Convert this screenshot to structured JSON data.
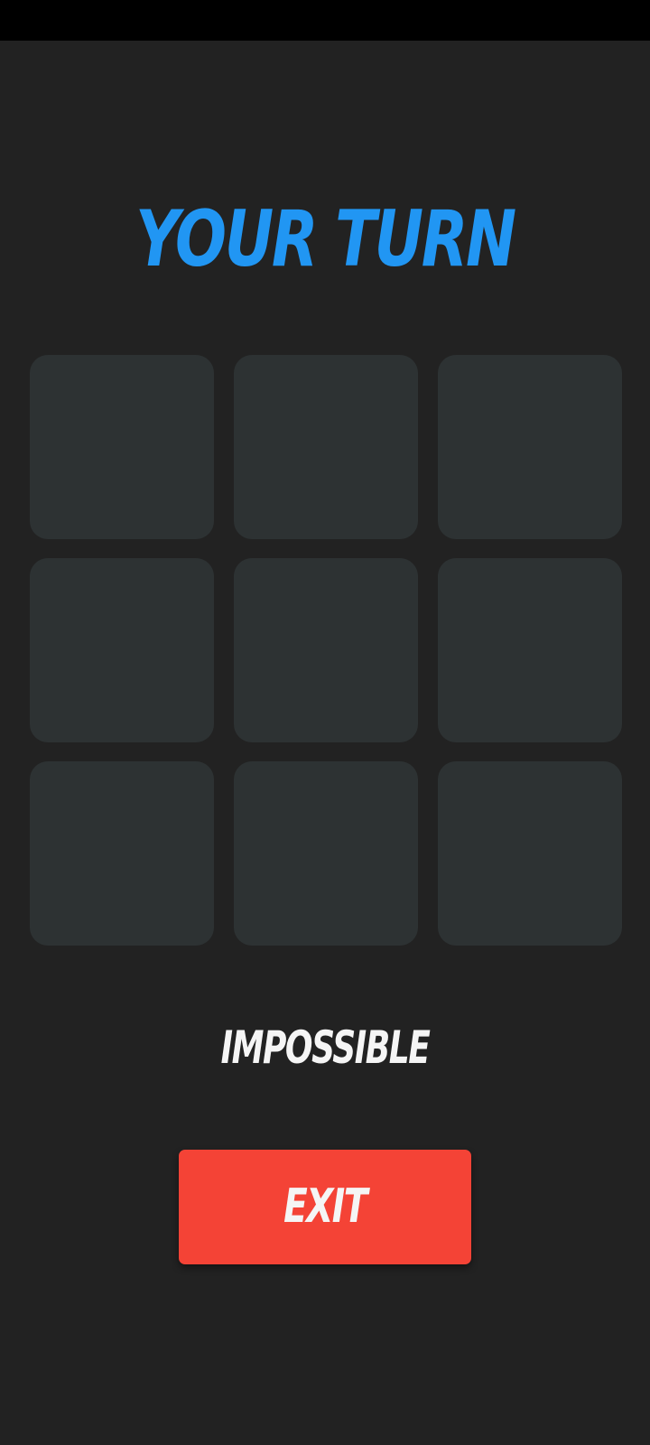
{
  "title": "YOUR TURN",
  "difficulty": "IMPOSSIBLE",
  "exit_button": {
    "label": "EXIT"
  },
  "board": {
    "rows": 3,
    "cols": 3,
    "cells": [
      "",
      "",
      "",
      "",
      "",
      "",
      "",
      "",
      ""
    ]
  },
  "colors": {
    "background": "#222222",
    "status_bar": "#000000",
    "title": "#2196F3",
    "cell": "#2D3233",
    "text": "#F5F5F5",
    "exit_button": "#F44336"
  }
}
